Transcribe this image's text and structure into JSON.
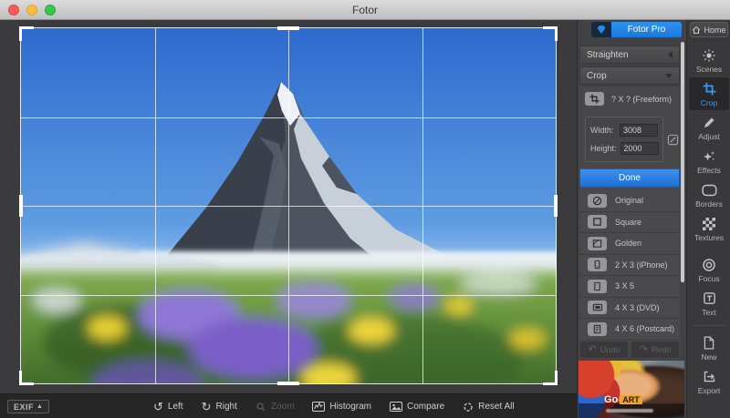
{
  "window": {
    "title": "Fotor"
  },
  "header": {
    "pro_button": {
      "label": "Fotor Pro"
    },
    "home_button": {
      "label": "Home"
    }
  },
  "panels": {
    "straighten": {
      "label": "Straighten"
    },
    "crop": {
      "label": "Crop",
      "freeform": {
        "label": "? X ? (Freeform)"
      },
      "width": {
        "label": "Width:",
        "value": "3008"
      },
      "height": {
        "label": "Height:",
        "value": "2000"
      },
      "done_label": "Done",
      "presets": [
        {
          "label": "Original"
        },
        {
          "label": "Square"
        },
        {
          "label": "Golden"
        },
        {
          "label": "2 X 3 (iPhone)"
        },
        {
          "label": "3 X 5"
        },
        {
          "label": "4 X 3 (DVD)"
        },
        {
          "label": "4 X 6 (Postcard)"
        }
      ]
    }
  },
  "history": {
    "undo_label": "Undo",
    "redo_label": "Redo"
  },
  "ad": {
    "title_go": "Go",
    "title_art": "ART"
  },
  "sidebar": {
    "items": [
      {
        "label": "Scenes"
      },
      {
        "label": "Crop",
        "active": true
      },
      {
        "label": "Adjust"
      },
      {
        "label": "Effects"
      },
      {
        "label": "Borders"
      },
      {
        "label": "Textures"
      },
      {
        "label": "Focus"
      },
      {
        "label": "Text"
      },
      {
        "label": "New"
      },
      {
        "label": "Export"
      }
    ]
  },
  "bottom_toolbar": {
    "exif_label": "EXIF",
    "buttons": [
      {
        "label": "Left"
      },
      {
        "label": "Right"
      },
      {
        "label": "Zoom",
        "disabled": true
      },
      {
        "label": "Histogram"
      },
      {
        "label": "Compare"
      },
      {
        "label": "Reset All"
      }
    ]
  },
  "colors": {
    "accent_blue": "#2a84e8",
    "done_button_blue": "#1f70d6",
    "active_tool_blue": "#4095ec",
    "ad_tag_orange": "#f0a32f",
    "crop_grid_white": "#ffffff"
  }
}
